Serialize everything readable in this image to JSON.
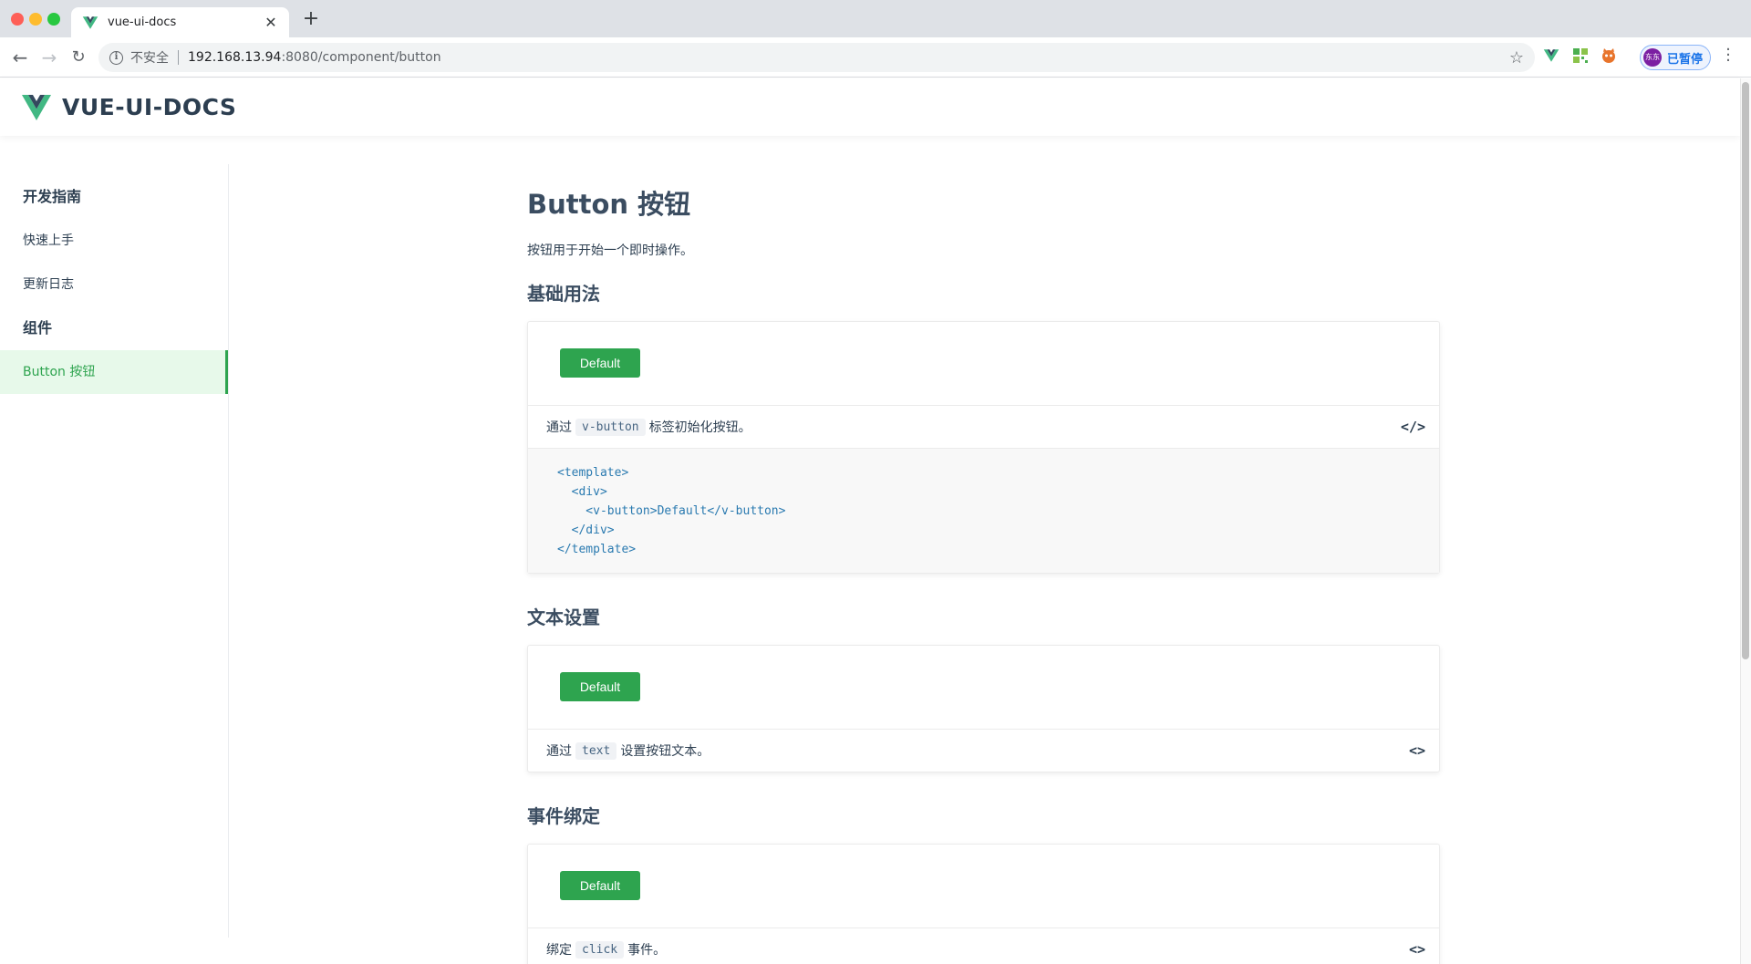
{
  "browser": {
    "tab_title": "vue-ui-docs",
    "insecure_label": "不安全",
    "url_host": "192.168.13.94",
    "url_path": ":8080/component/button",
    "profile_label": "已暂停",
    "profile_avatar": "东东"
  },
  "header": {
    "site_title": "VUE-UI-DOCS"
  },
  "sidebar": {
    "items": [
      {
        "label": "开发指南",
        "type": "group"
      },
      {
        "label": "快速上手",
        "type": "item"
      },
      {
        "label": "更新日志",
        "type": "item"
      },
      {
        "label": "组件",
        "type": "group"
      },
      {
        "label": "Button 按钮",
        "type": "item",
        "active": true
      }
    ]
  },
  "main": {
    "title": "Button 按钮",
    "description": "按钮用于开始一个即时操作。",
    "sections": [
      {
        "title": "基础用法",
        "button_label": "Default",
        "meta_prefix": "通过",
        "meta_code": "v-button",
        "meta_suffix": "标签初始化按钮。",
        "toggle": "</>",
        "code_lines": [
          "<template>",
          "  <div>",
          "    <v-button>Default</v-button>",
          "  </div>",
          "</template>"
        ]
      },
      {
        "title": "文本设置",
        "button_label": "Default",
        "meta_prefix": "通过",
        "meta_code": "text",
        "meta_suffix": "设置按钮文本。",
        "toggle": "<>"
      },
      {
        "title": "事件绑定",
        "button_label": "Default",
        "meta_prefix": "绑定",
        "meta_code": "click",
        "meta_suffix": "事件。",
        "toggle": "<>"
      }
    ]
  },
  "colors": {
    "brand_green": "#2ea44f",
    "active_bg": "#e7f9ea",
    "heading": "#3b4d61"
  }
}
